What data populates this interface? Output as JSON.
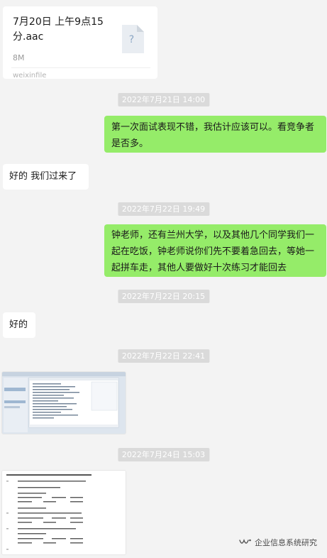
{
  "file_message": {
    "name": "7月20日 上午9点15分.aac",
    "size": "8M",
    "source": "weixinfile",
    "icon": "unknown-file-icon",
    "icon_glyph": "?"
  },
  "timestamps": [
    "2022年7月21日 14:00",
    "2022年7月22日 19:49",
    "2022年7月22日 20:15",
    "2022年7月22日 22:41",
    "2022年7月24日 15:03"
  ],
  "messages": {
    "sent_1": "第一次面试表现不错，我估计应该可以。看竞争者是否多。",
    "received_1": "好的 我们过来了",
    "sent_2": "钟老师，还有兰州大学，以及其他几个同学我们一起在吃饭，钟老师说你们先不要着急回去，等她一起拼车走，其他人要做好十次练习才能回去",
    "received_2": "好的"
  },
  "images": [
    {
      "icon": "screenshot-thumbnail"
    },
    {
      "icon": "document-thumbnail"
    }
  ],
  "watermark": {
    "text": "企业信息系统研究",
    "icon": "wechat-channel-logo"
  },
  "colors": {
    "background": "#f3f3f3",
    "sent_bubble": "#95ec69",
    "received_bubble": "#ffffff",
    "timestamp_bg": "#dadada"
  }
}
